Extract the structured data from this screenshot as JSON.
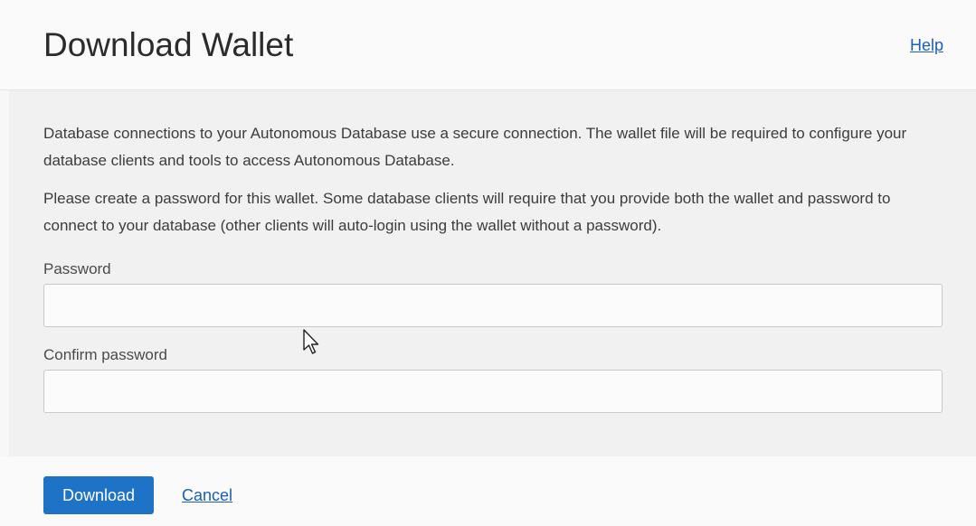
{
  "dialog": {
    "title": "Download Wallet",
    "help_label": "Help"
  },
  "body": {
    "paragraph_1": "Database connections to your Autonomous Database use a secure connection. The wallet file will be required to configure your database clients and tools to access Autonomous Database.",
    "paragraph_2": "Please create a password for this wallet. Some database clients will require that you provide both the wallet and password to connect to your database (other clients will auto-login using the wallet without a password).",
    "password": {
      "label": "Password",
      "value": "",
      "placeholder": ""
    },
    "confirm_password": {
      "label": "Confirm password",
      "value": "",
      "placeholder": ""
    }
  },
  "footer": {
    "download_label": "Download",
    "cancel_label": "Cancel"
  },
  "colors": {
    "primary_button": "#1f73c6",
    "link": "#1a5fb4"
  },
  "icons": {
    "cursor": "mouse-pointer-icon"
  }
}
